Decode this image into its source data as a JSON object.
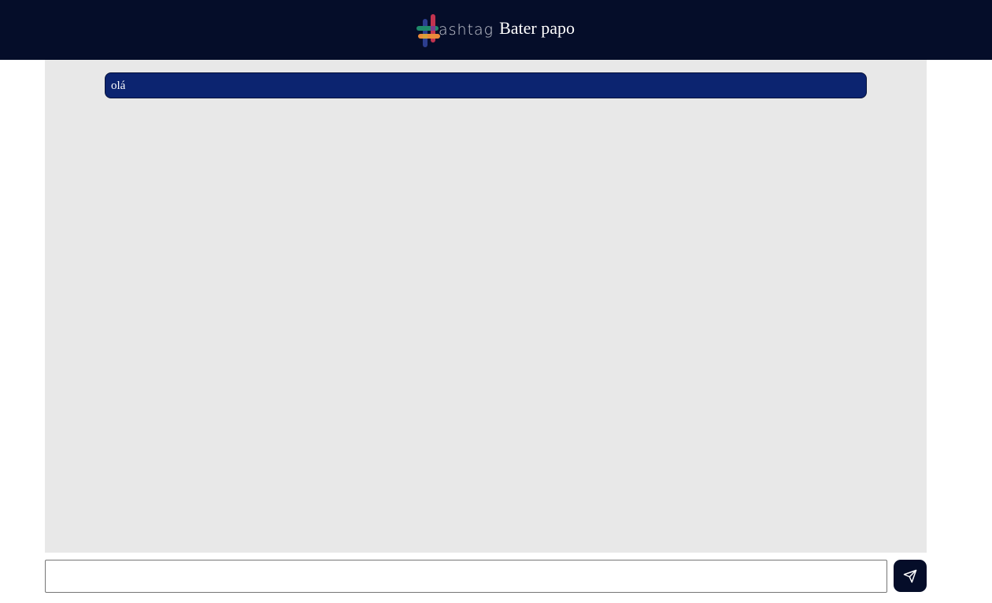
{
  "header": {
    "logo_text": "ashtag",
    "title": "Bater papo",
    "background": "#050d29"
  },
  "chat": {
    "background": "#e8e8e8",
    "messages": [
      {
        "text": "olá",
        "background": "#0c2470"
      }
    ]
  },
  "composer": {
    "input_value": "",
    "send_icon": "send-icon"
  }
}
